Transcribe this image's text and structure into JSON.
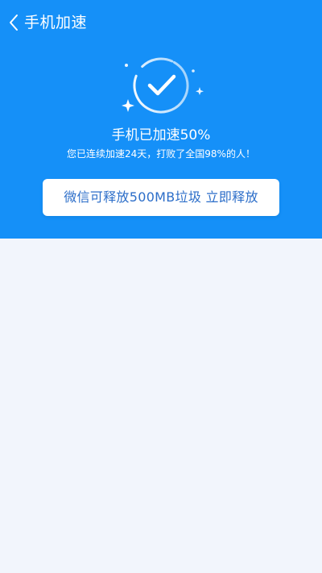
{
  "header": {
    "title": "手机加速",
    "back_icon": "chevron-left-icon",
    "background_color": "#1590f8"
  },
  "status": {
    "badge_icon": "checkmark-circle-icon",
    "headline": "手机已加速50%",
    "subline": "您已连续加速24天，打败了全国98%的人！"
  },
  "action": {
    "label": "微信可释放500MB垃圾 立即释放",
    "text_color": "#2c6ec9"
  },
  "page": {
    "background_color": "#f2f5fc"
  }
}
